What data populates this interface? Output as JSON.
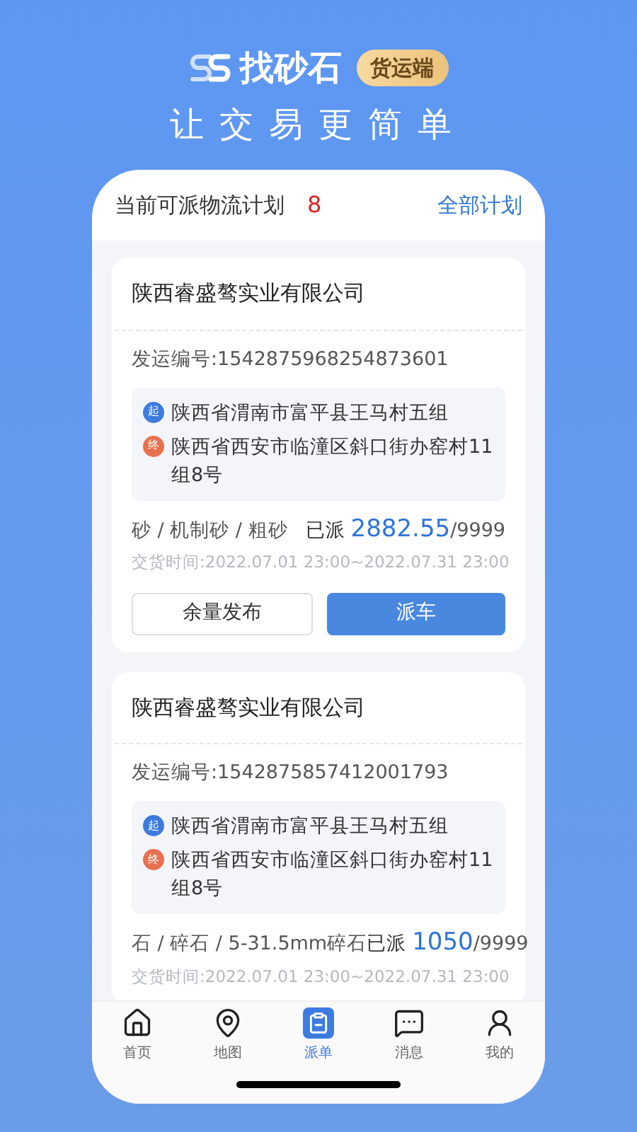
{
  "brand": {
    "name": "找砂石",
    "badge": "货运端",
    "slogan": "让交易更简单"
  },
  "header": {
    "title": "当前可派物流计划",
    "count": "8",
    "link": "全部计划"
  },
  "plans": [
    {
      "company": "陕西睿盛骜实业有限公司",
      "shipment_no": "发运编号:1542875968254873601",
      "origin_tag": "起",
      "origin": "陕西省渭南市富平县王马村五组",
      "destination_tag": "终",
      "destination": "陕西省西安市临潼区斜口街办窑村11组8号",
      "goods": "砂 / 机制砂 / 粗砂",
      "dispatched_label": "已派",
      "dispatched": "2882.55",
      "total": "/9999",
      "delivery_time": "交货时间:2022.07.01 23:00~2022.07.31 23:00",
      "buttons": [
        {
          "label": "余量发布",
          "kind": "outline"
        },
        {
          "label": "派车",
          "kind": "primary"
        }
      ]
    },
    {
      "company": "陕西睿盛骜实业有限公司",
      "shipment_no": "发运编号:1542875857412001793",
      "origin_tag": "起",
      "origin": "陕西省渭南市富平县王马村五组",
      "destination_tag": "终",
      "destination": "陕西省西安市临潼区斜口街办窑村11组8号",
      "goods": "石 / 碎石 / 5-31.5mm碎石",
      "dispatched_label": "已派",
      "dispatched": "1050",
      "total": "/9999",
      "delivery_time": "交货时间:2022.07.01 23:00~2022.07.31 23:00"
    }
  ],
  "tabs": [
    {
      "label": "首页",
      "selected": false
    },
    {
      "label": "地图",
      "selected": false
    },
    {
      "label": "派单",
      "selected": true
    },
    {
      "label": "消息",
      "selected": false
    },
    {
      "label": "我的",
      "selected": false
    }
  ]
}
